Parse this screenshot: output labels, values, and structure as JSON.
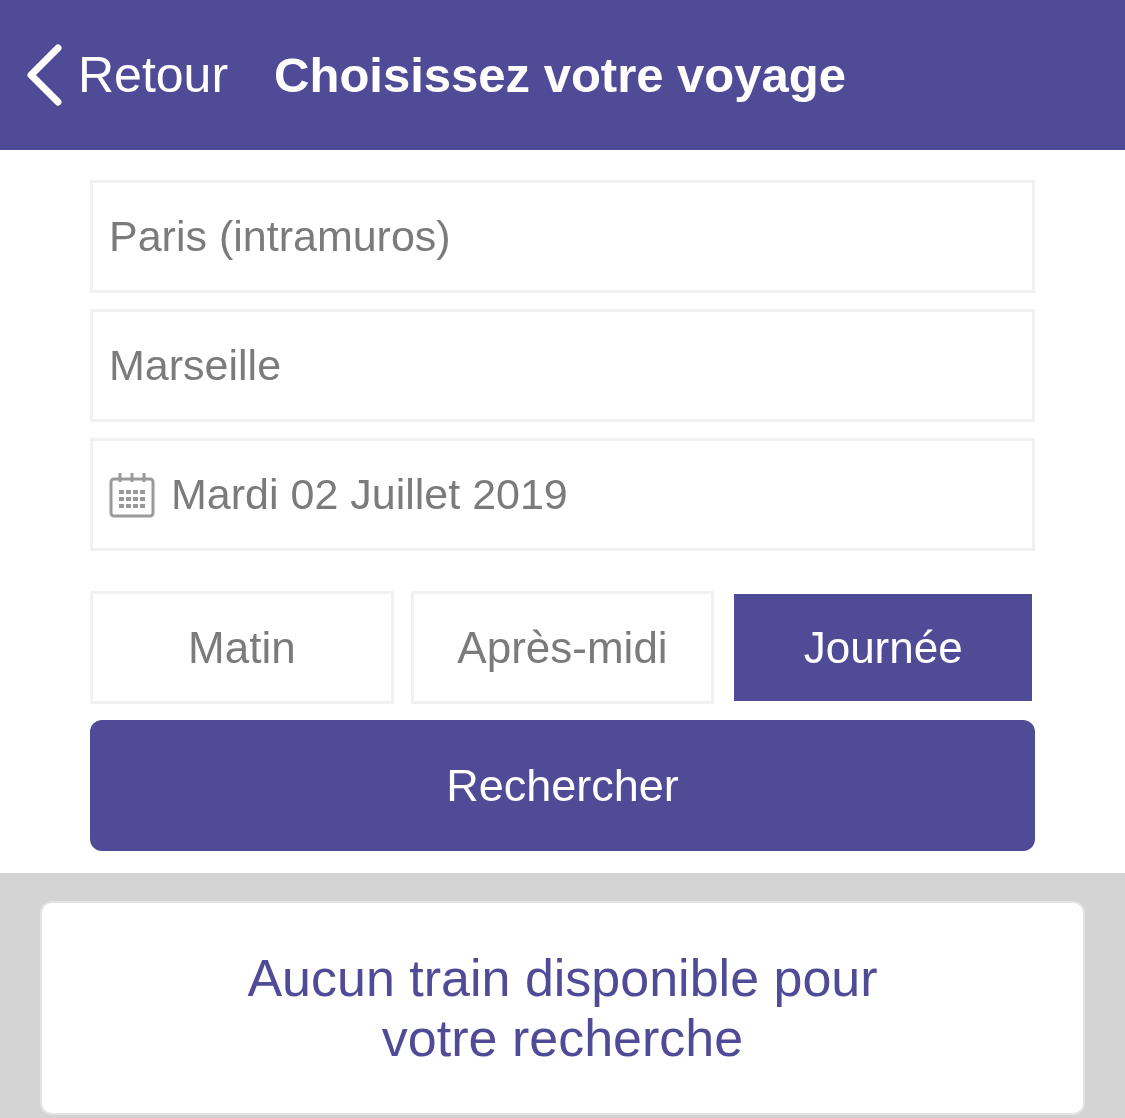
{
  "header": {
    "back_label": "Retour",
    "title": "Choisissez votre voyage"
  },
  "fields": [
    {
      "kind": "text",
      "value": "Paris (intramuros)"
    },
    {
      "kind": "text",
      "value": "Marseille"
    },
    {
      "kind": "date",
      "value": "Mardi 02 Juillet 2019"
    }
  ],
  "periods": [
    {
      "label": "Matin",
      "selected": false
    },
    {
      "label": "Après-midi",
      "selected": false
    },
    {
      "label": "Journée",
      "selected": true
    }
  ],
  "search_button": "Rechercher",
  "result": {
    "message": "Aucun train disponible pour votre recherche"
  }
}
